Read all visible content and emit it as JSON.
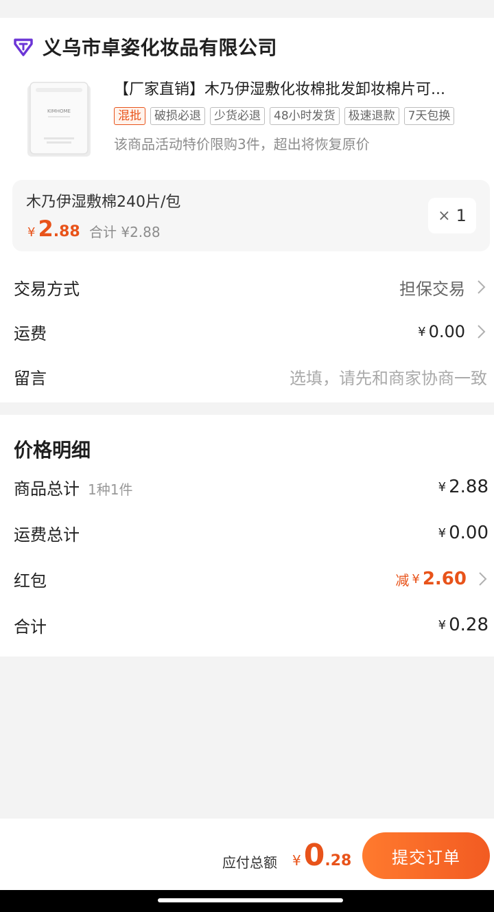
{
  "store": {
    "name": "义乌市卓姿化妆品有限公司"
  },
  "product": {
    "title": "【厂家直销】木乃伊湿敷化妆棉批发卸妆棉片可...",
    "tags": [
      "混批",
      "破损必退",
      "少货必退",
      "48小时发货",
      "极速退款",
      "7天包换"
    ],
    "promo_note": "该商品活动特价限购3件，超出将恢复原价",
    "image_brand": "KIMHOME",
    "sku": {
      "name": "木乃伊湿敷棉240片/包",
      "currency": "¥",
      "price_int": "2",
      "price_dec": ".88",
      "subtotal": "合计 ¥2.88",
      "qty_x": "×",
      "qty": "1"
    }
  },
  "order_rows": {
    "trade_label": "交易方式",
    "trade_value": "担保交易",
    "shipping_label": "运费",
    "shipping_currency": "¥",
    "shipping_value": "0.00",
    "message_label": "留言",
    "message_placeholder": "选填，请先和商家协商一致"
  },
  "price_detail": {
    "title": "价格明细",
    "goods_total_label": "商品总计",
    "goods_total_note": "1种1件",
    "goods_total_currency": "¥",
    "goods_total_value": "2.88",
    "shipping_total_label": "运费总计",
    "shipping_total_currency": "¥",
    "shipping_total_value": "0.00",
    "red_packet_label": "红包",
    "red_packet_minus": "减",
    "red_packet_currency": "¥",
    "red_packet_value": "2.60",
    "sum_label": "合计",
    "sum_currency": "¥",
    "sum_value": "0.28"
  },
  "bottom_bar": {
    "pay_label": "应付总额",
    "currency": "¥",
    "amount_int": "0",
    "amount_dec": ".28",
    "submit_label": "提交订单"
  },
  "colors": {
    "accent": "#e8531a",
    "brand_logo": "#6b35d6"
  }
}
